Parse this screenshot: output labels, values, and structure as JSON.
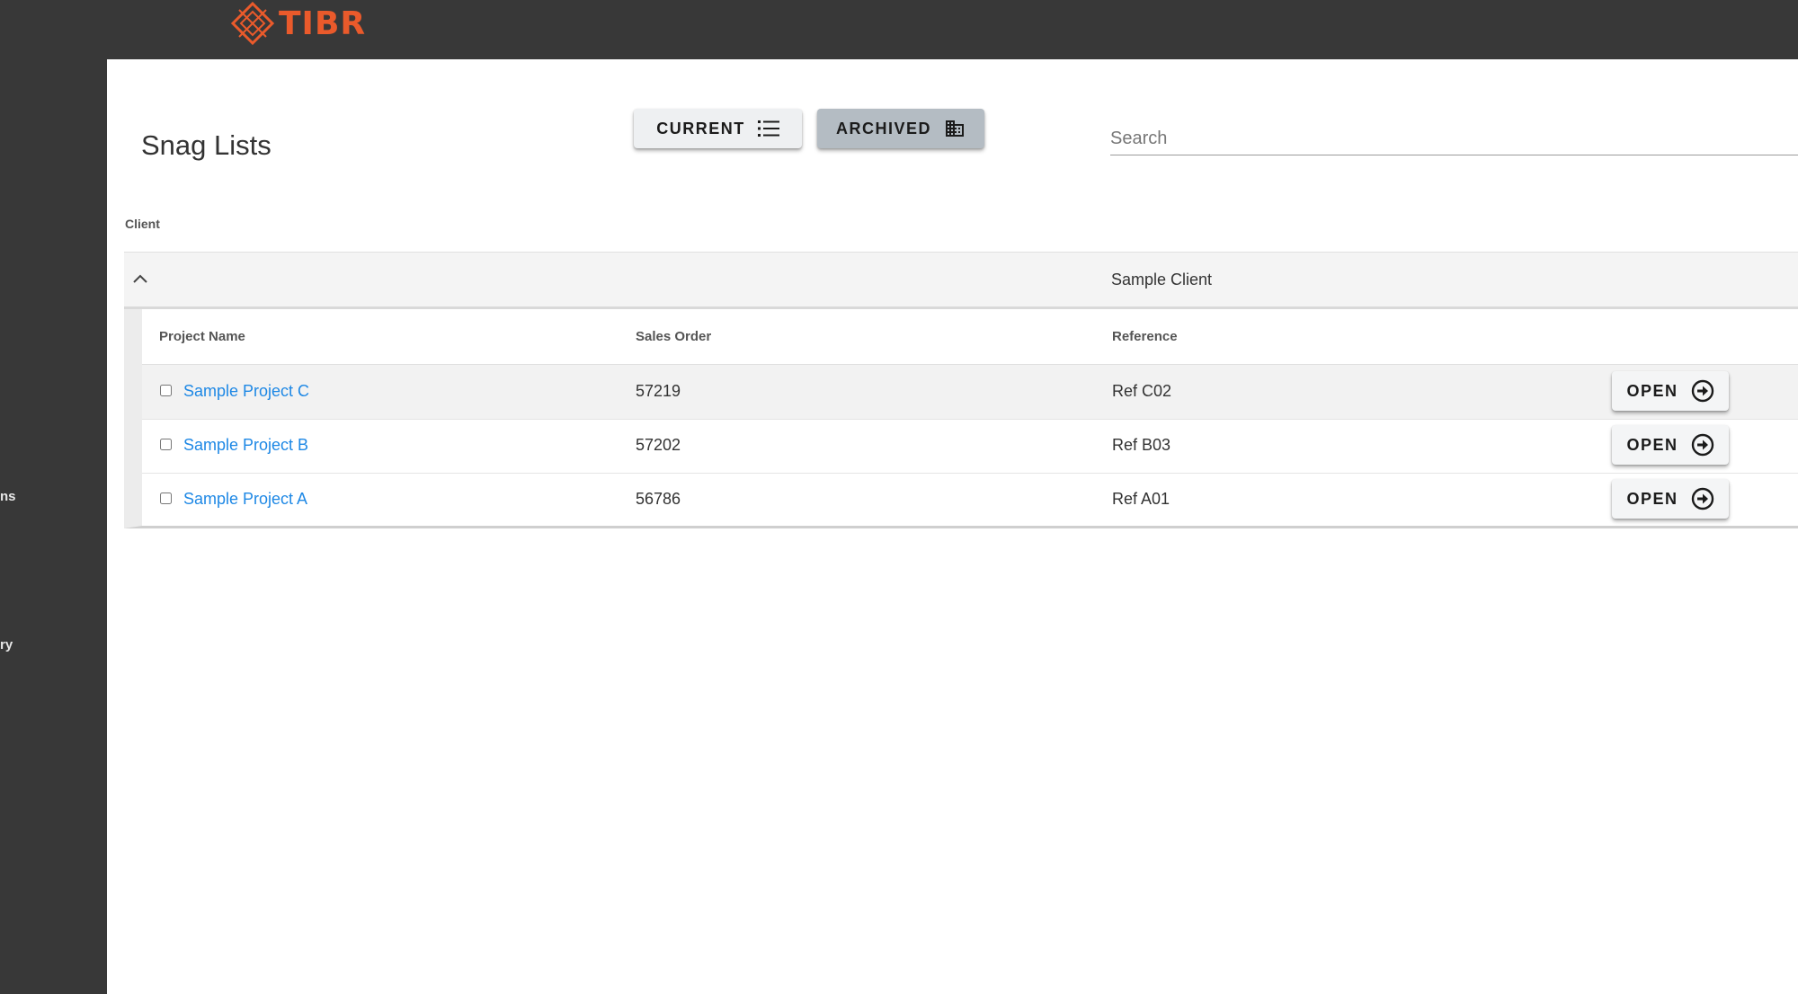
{
  "app": {
    "logo_text": "TIBR",
    "brand_color": "#ea5a2b"
  },
  "sidebar": {
    "items": [
      {
        "label": "ns"
      },
      {
        "label": "ry"
      }
    ]
  },
  "page": {
    "title": "Snag Lists"
  },
  "toolbar": {
    "current_label": "CURRENT",
    "current_icon": "list-icon",
    "archived_label": "ARCHIVED",
    "archived_icon": "building-icon"
  },
  "search": {
    "placeholder": "Search",
    "value": ""
  },
  "table": {
    "group_header": "Client",
    "group": {
      "label": "Sample Client",
      "expanded": true
    },
    "columns": [
      "Project Name",
      "Sales Order",
      "Reference"
    ],
    "rows": [
      {
        "project": "Sample Project C",
        "sales_order": "57219",
        "reference": "Ref C02",
        "action": "OPEN"
      },
      {
        "project": "Sample Project B",
        "sales_order": "57202",
        "reference": "Ref B03",
        "action": "OPEN"
      },
      {
        "project": "Sample Project A",
        "sales_order": "56786",
        "reference": "Ref A01",
        "action": "OPEN"
      }
    ]
  }
}
